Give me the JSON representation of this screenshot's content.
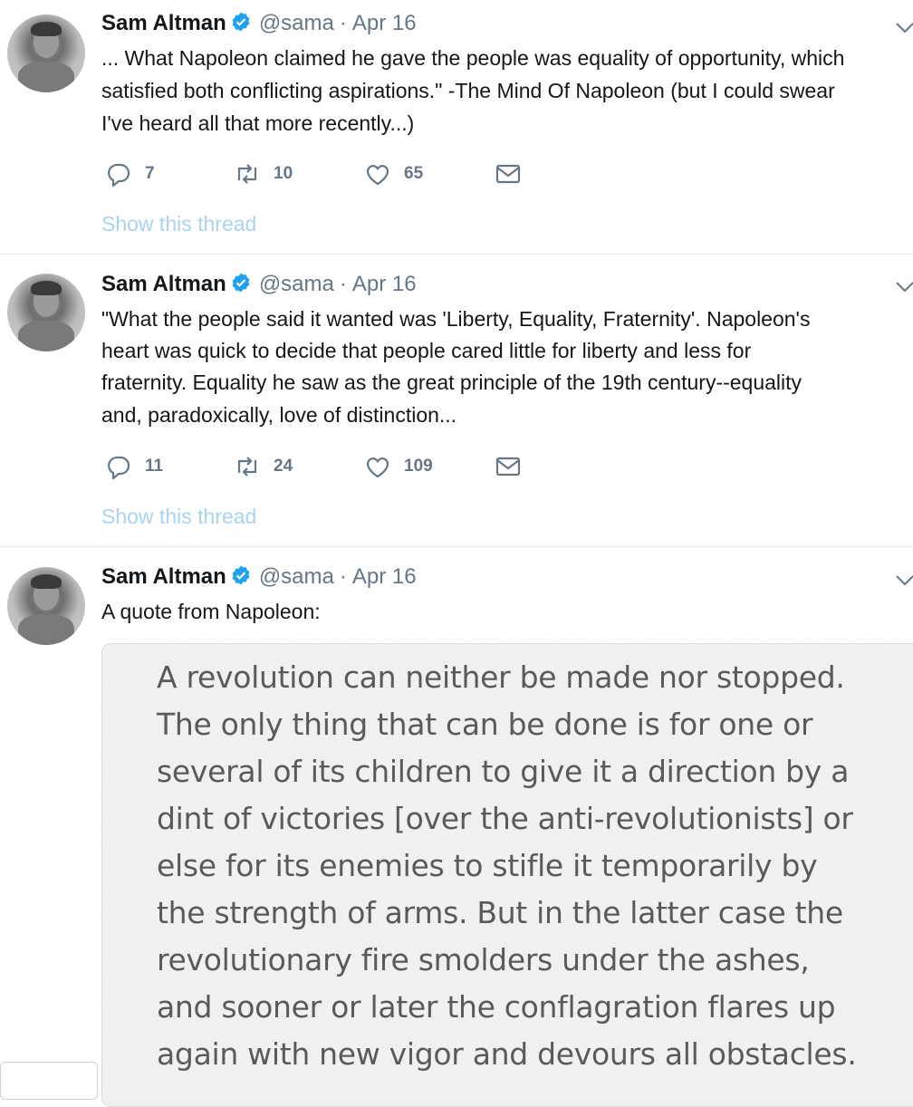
{
  "tweets": [
    {
      "author": "Sam Altman",
      "handle": "@sama",
      "date": "Apr 16",
      "lines": [
        "... What Napoleon claimed he gave the people was equality of opportunity, which",
        "satisfied both conflicting aspirations.\" -The Mind Of Napoleon (but I could swear",
        "I've heard all that more recently...)"
      ],
      "replies": "7",
      "retweets": "10",
      "likes": "65",
      "show_thread": "Show this thread"
    },
    {
      "author": "Sam Altman",
      "handle": "@sama",
      "date": "Apr 16",
      "lines": [
        "\"What the people said it wanted was 'Liberty, Equality, Fraternity'. Napoleon's",
        "heart was quick to decide that people cared little for liberty and less for",
        "fraternity. Equality he saw as the great principle of the 19th century--equality",
        "and, paradoxically, love of distinction..."
      ],
      "replies": "11",
      "retweets": "24",
      "likes": "109",
      "show_thread": "Show this thread"
    },
    {
      "author": "Sam Altman",
      "handle": "@sama",
      "date": "Apr 16",
      "lines": [
        "A quote from Napoleon:"
      ],
      "quote_image_lines": [
        "A revolution can neither be made nor stopped.",
        "The only thing that can be done is for one or",
        "several of its children to give it a direction by a",
        "dint of victories [over the anti-revolutionists] or",
        "else for its enemies to stifle it temporarily by",
        "the strength of arms. But in the latter case the",
        "revolutionary fire smolders under the ashes,",
        "and sooner or later the conflagration flares up",
        "again with new vigor and devours all obstacles."
      ]
    }
  ],
  "colors": {
    "name": "#14171a",
    "meta": "#657786",
    "verified": "#1da1f2",
    "show_thread": "#a9d3f2",
    "divider": "#e1e8ed"
  },
  "icons": {
    "reply": "reply-icon",
    "retweet": "retweet-icon",
    "like": "heart-icon",
    "dm": "envelope-icon",
    "verified": "verified-badge-icon",
    "caret": "chevron-down-icon"
  }
}
